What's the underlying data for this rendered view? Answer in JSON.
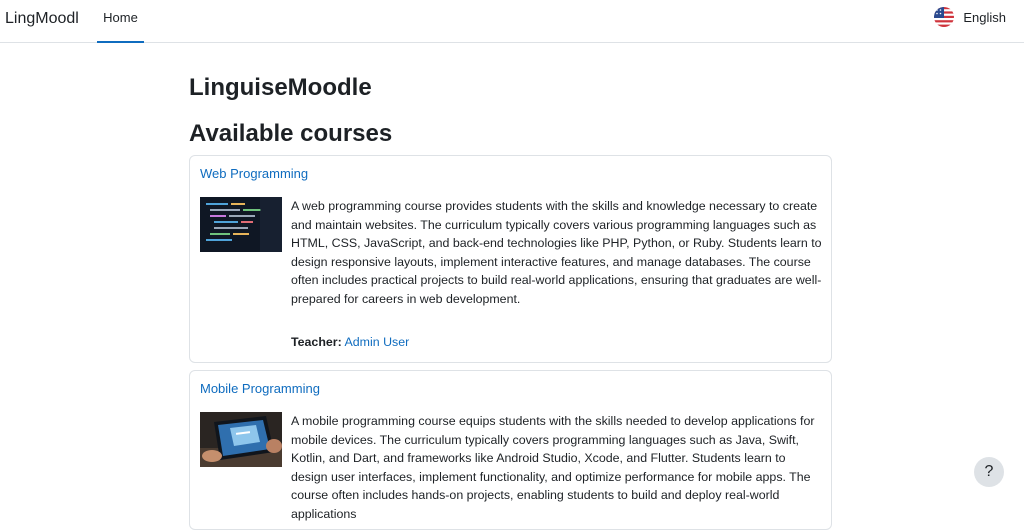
{
  "navbar": {
    "brand": "LingMoodl",
    "home_label": "Home",
    "language_label": "English",
    "language_flag_icon": "us-flag-icon",
    "accent_color": "#0f6cbf"
  },
  "main": {
    "site_title": "LinguiseMoodle",
    "section_title": "Available courses"
  },
  "courses": [
    {
      "name": "Web Programming",
      "image_icon": "code-editor-thumbnail",
      "summary": "A web programming course provides students with the skills and knowledge necessary to create and maintain websites. The curriculum typically covers various programming languages such as HTML, CSS, JavaScript, and back-end technologies like PHP, Python, or Ruby. Students learn to design responsive layouts, implement interactive features, and manage databases. The course often includes practical projects to build real-world applications, ensuring that graduates are well-prepared for careers in web development.",
      "teacher_label": "Teacher:",
      "teacher_name": "Admin User"
    },
    {
      "name": "Mobile Programming",
      "image_icon": "tablet-in-hands-thumbnail",
      "summary": "A mobile programming course equips students with the skills needed to develop applications for mobile devices. The curriculum typically covers programming languages such as Java, Swift, Kotlin, and Dart, and frameworks like Android Studio, Xcode, and Flutter. Students learn to design user interfaces, implement functionality, and optimize performance for mobile apps. The course often includes hands-on projects, enabling students to build and deploy real-world applications"
    }
  ],
  "help": {
    "label": "?"
  }
}
